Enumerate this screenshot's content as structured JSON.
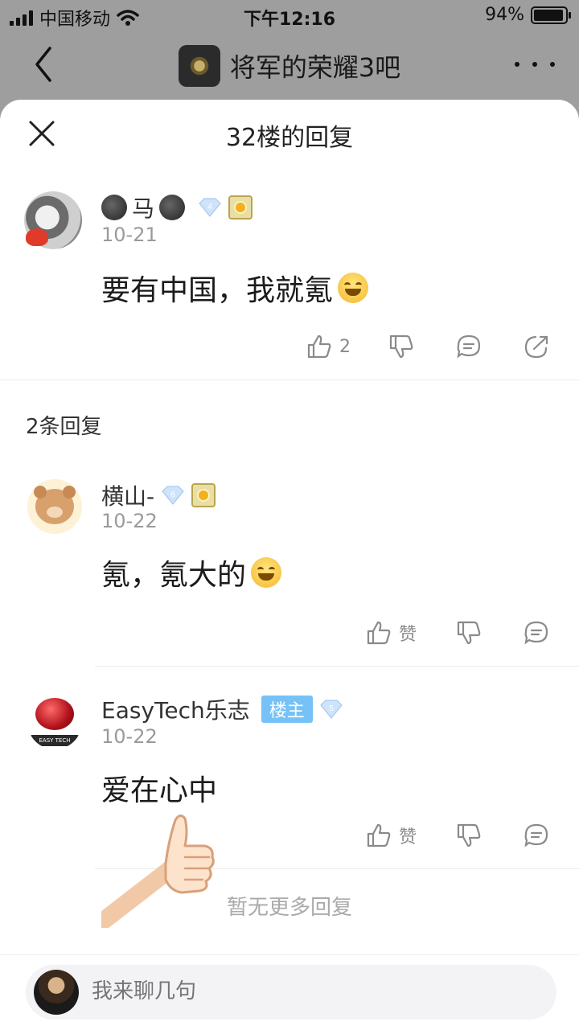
{
  "status_bar": {
    "carrier": "中国移动",
    "time": "下午12:16",
    "battery": "94%",
    "battery_level": 0.94
  },
  "nav": {
    "forum_title": "将军的荣耀3吧"
  },
  "sheet": {
    "title": "32楼的回复"
  },
  "main_post": {
    "username": "马",
    "level": "4",
    "date": "10-21",
    "content": "要有中国，我就氪",
    "like_count": "2"
  },
  "replies_label": "2条回复",
  "replies": [
    {
      "username": "横山-",
      "level": "6",
      "date": "10-22",
      "content": "氪，氪大的",
      "like_label": "赞"
    },
    {
      "username": "EasyTech乐志",
      "owner_tag": "楼主",
      "level": "5",
      "date": "10-22",
      "content": "爱在心中",
      "like_label": "赞",
      "avatar_text": "EASY TECH"
    }
  ],
  "no_more": "暂无更多回复",
  "input": {
    "placeholder": "我来聊几句"
  },
  "colors": {
    "accent_blue": "#76c2f7",
    "muted": "#9a9a9a"
  }
}
